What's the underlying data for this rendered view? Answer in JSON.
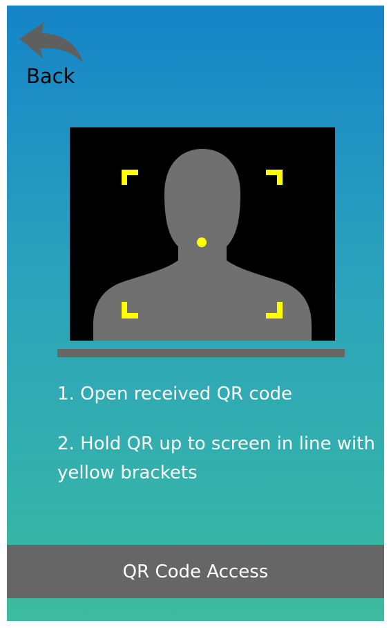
{
  "nav": {
    "back_label": "Back",
    "back_icon": "back-arrow-icon"
  },
  "camera_preview": {
    "target_icon": "person-silhouette",
    "bracket_color": "#ffff00",
    "silhouette_color": "#707070",
    "background_color": "#000000"
  },
  "instructions": {
    "step1": "1. Open received QR code",
    "step2": "2. Hold QR up to screen in line with yellow brackets"
  },
  "footer": {
    "title": "QR Code Access"
  },
  "colors": {
    "gradient_top": "#1584c8",
    "gradient_bottom": "#3dbb9e",
    "bar": "#666666",
    "text": "#ffffff"
  }
}
